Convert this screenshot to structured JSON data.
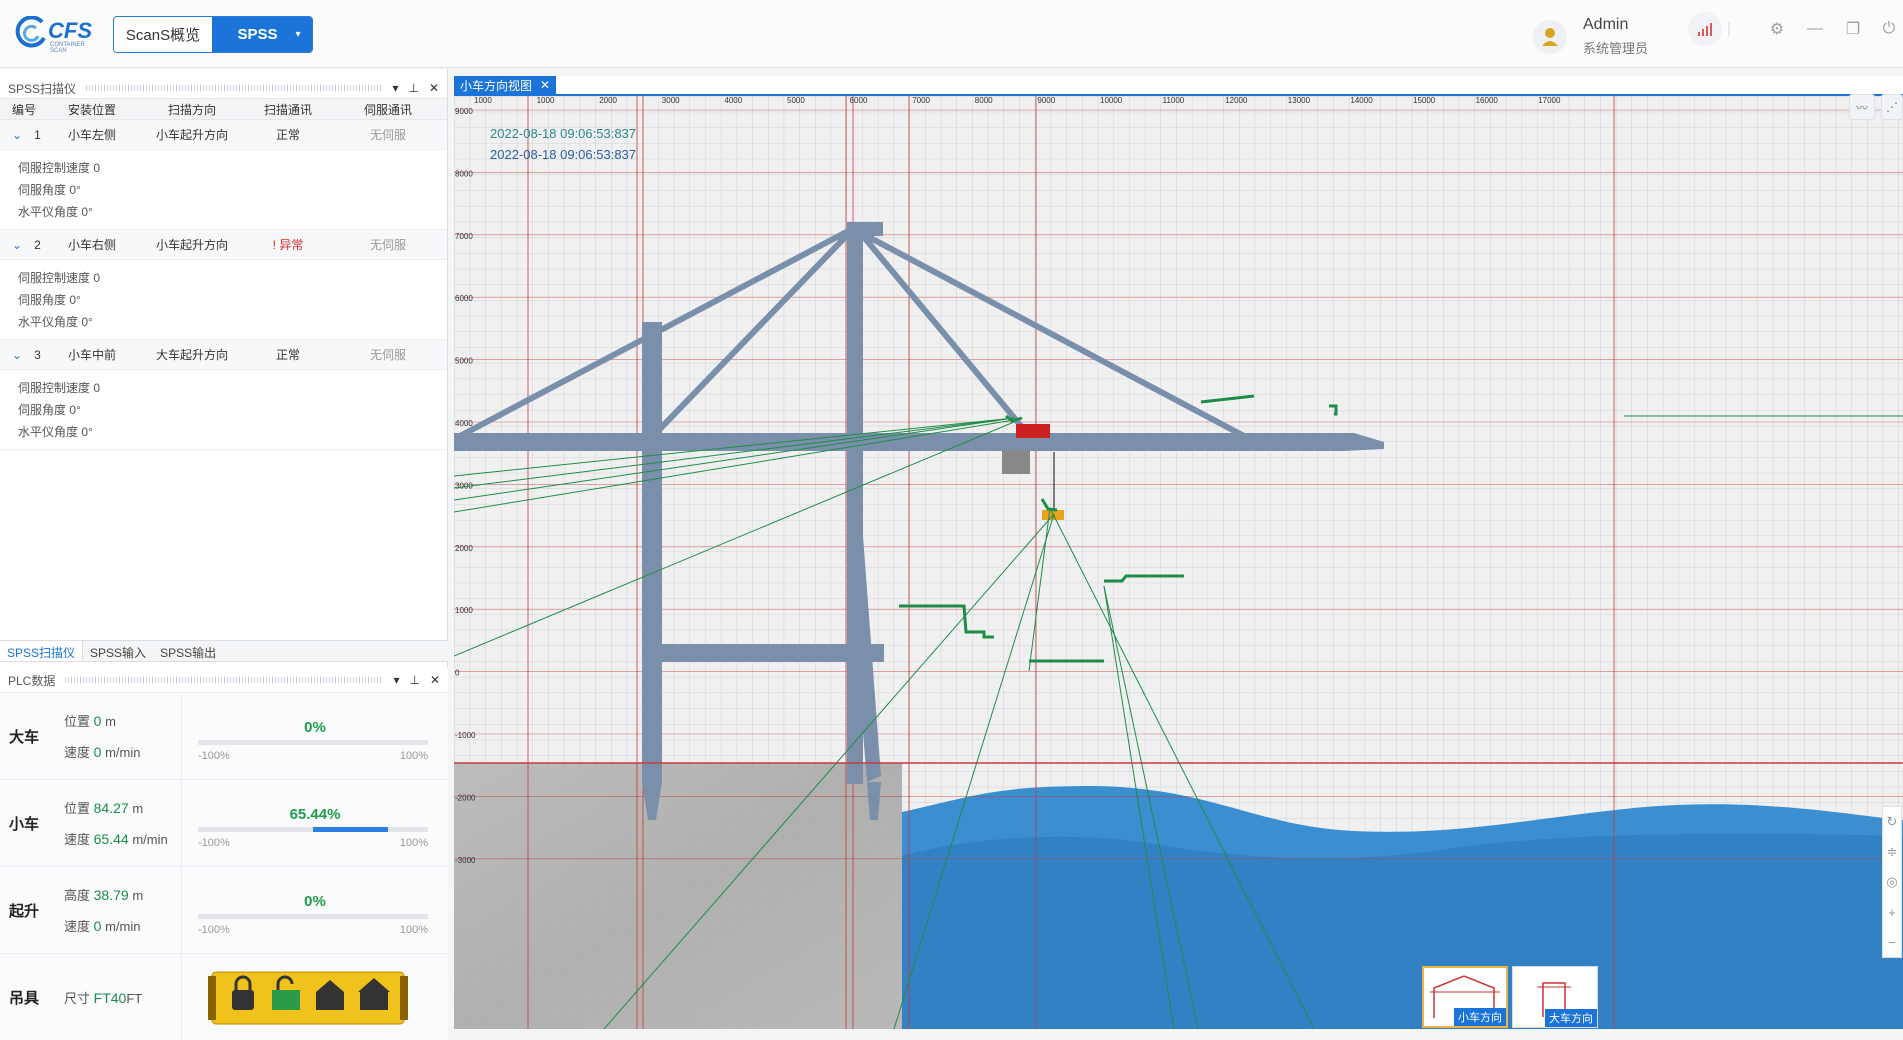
{
  "header": {
    "logo_text": "CFS",
    "logo_sub": "CONTAINER SCAN",
    "nav_tab_1": "ScanS概览",
    "nav_tab_2": "SPSS",
    "user_name": "Admin",
    "user_role": "系统管理员"
  },
  "scanner_panel": {
    "title": "SPSS扫描仪",
    "columns": [
      "编号",
      "安装位置",
      "扫描方向",
      "扫描通讯",
      "伺服通讯"
    ],
    "rows": [
      {
        "id": "1",
        "location": "小车左侧",
        "direction": "小车起升方向",
        "comm": "正常",
        "servo": "无伺服",
        "speed": "伺服控制速度 0",
        "angle": "伺服角度 0°",
        "level": "水平仪角度 0°"
      },
      {
        "id": "2",
        "location": "小车右侧",
        "direction": "小车起升方向",
        "comm": "! 异常",
        "servo": "无伺服",
        "speed": "伺服控制速度 0",
        "angle": "伺服角度 0°",
        "level": "水平仪角度 0°"
      },
      {
        "id": "3",
        "location": "小车中前",
        "direction": "大车起升方向",
        "comm": "正常",
        "servo": "无伺服",
        "speed": "伺服控制速度 0",
        "angle": "伺服角度 0°",
        "level": "水平仪角度 0°"
      }
    ],
    "tabs": [
      "SPSS扫描仪",
      "SPSS输入",
      "SPSS输出"
    ]
  },
  "plc_panel": {
    "title": "PLC数据",
    "gantry": {
      "label": "大车",
      "pos_label": "位置",
      "pos": "0",
      "pos_unit": "m",
      "spd_label": "速度",
      "spd": "0",
      "spd_unit": "m/min",
      "pct": "0%",
      "value": 0,
      "lo": "-100%",
      "hi": "100%"
    },
    "trolley": {
      "label": "小车",
      "pos_label": "位置",
      "pos": "84.27",
      "pos_unit": "m",
      "spd_label": "速度",
      "spd": "65.44",
      "spd_unit": "m/min",
      "pct": "65.44%",
      "value": 65.44,
      "lo": "-100%",
      "hi": "100%"
    },
    "hoist": {
      "label": "起升",
      "pos_label": "高度",
      "pos": "38.79",
      "pos_unit": "m",
      "spd_label": "速度",
      "spd": "0",
      "spd_unit": "m/min",
      "pct": "0%",
      "value": 0,
      "lo": "-100%",
      "hi": "100%"
    },
    "spreader": {
      "label": "吊具",
      "size_label": "尺寸",
      "size": "FT40",
      "size_unit": "FT"
    }
  },
  "view": {
    "tab_title": "小车方向视图",
    "timestamp_1": "2022-08-18 09:06:53:837",
    "timestamp_2": "2022-08-18 09:06:53:837",
    "x_ticks": [
      "1000",
      "1000",
      "2000",
      "3000",
      "4000",
      "5000",
      "6000",
      "7000",
      "8000",
      "9000",
      "10000",
      "11000",
      "12000",
      "13000",
      "14000",
      "15000",
      "16000",
      "17000"
    ],
    "y_ticks": [
      "9000",
      "8000",
      "7000",
      "6000",
      "5000",
      "4000",
      "3000",
      "2000",
      "1000",
      "0",
      "-1000",
      "-2000",
      "-3000"
    ],
    "thumb_1": "小车方向",
    "thumb_2": "大车方向"
  },
  "colors": {
    "accent": "#1d74d8",
    "crane": "#7a8faa",
    "scan": "#1e8d48",
    "water": "#3b8ed0",
    "ok_green": "#1e9d4a",
    "alert": "#d42a2a"
  }
}
